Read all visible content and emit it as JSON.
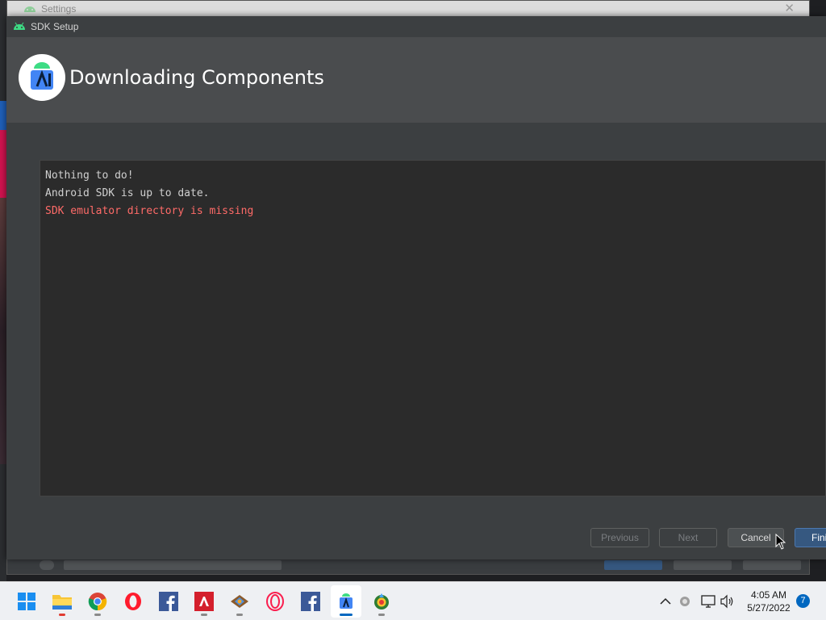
{
  "settings_window": {
    "title": "Settings"
  },
  "dialog": {
    "title": "SDK Setup",
    "header_title": "Downloading Components",
    "console_lines": [
      {
        "text": "Nothing to do!",
        "type": "normal"
      },
      {
        "text": "Android SDK is up to date.",
        "type": "normal"
      },
      {
        "text": "SDK emulator directory is missing",
        "type": "error"
      }
    ],
    "buttons": {
      "previous": "Previous",
      "next": "Next",
      "cancel": "Cancel",
      "finish": "Finish"
    }
  },
  "taskbar": {
    "apps": [
      {
        "name": "start-menu-icon"
      },
      {
        "name": "file-explorer-icon"
      },
      {
        "name": "chrome-icon"
      },
      {
        "name": "opera-icon"
      },
      {
        "name": "facebook-icon"
      },
      {
        "name": "amd-icon"
      },
      {
        "name": "app-icon"
      },
      {
        "name": "opera-gx-icon"
      },
      {
        "name": "facebook-icon"
      },
      {
        "name": "android-studio-icon"
      },
      {
        "name": "app-icon"
      }
    ],
    "clock": {
      "time": "4:05 AM",
      "date": "5/27/2022"
    },
    "notification_count": "7"
  },
  "colors": {
    "dialog_bg": "#3c3f41",
    "header_bg": "#4a4c4e",
    "console_bg": "#2b2b2b",
    "error_text": "#ff6b68",
    "finish_button": "#365880",
    "taskbar_accent": "#0067c0"
  }
}
